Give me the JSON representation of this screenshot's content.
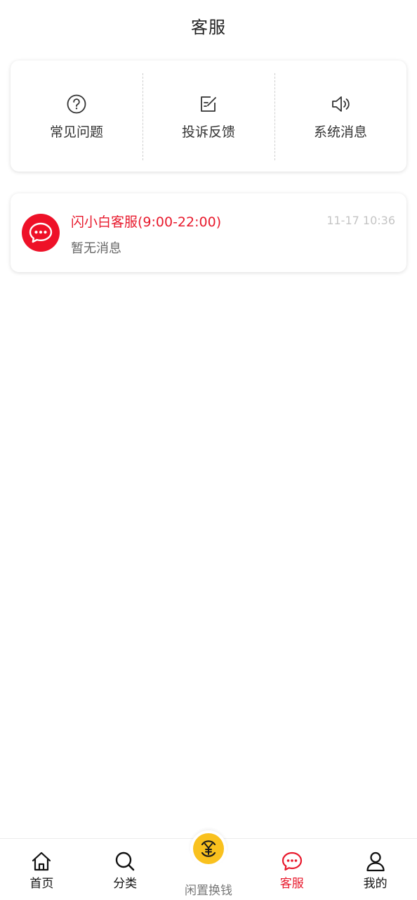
{
  "header": {
    "title": "客服"
  },
  "quick_actions": [
    {
      "label": "常见问题",
      "icon": "question-circle-icon"
    },
    {
      "label": "投诉反馈",
      "icon": "edit-note-icon"
    },
    {
      "label": "系统消息",
      "icon": "speaker-icon"
    }
  ],
  "conversation": {
    "name": "闪小白客服(9:00-22:00)",
    "time": "11-17 10:36",
    "preview": "暂无消息",
    "avatar_icon": "chat-bubble-icon"
  },
  "tabbar": {
    "items": [
      {
        "label": "首页",
        "icon": "home-icon"
      },
      {
        "label": "分类",
        "icon": "search-icon"
      },
      {
        "label": "闲置换钱",
        "icon": "yuan-coin-icon"
      },
      {
        "label": "客服",
        "icon": "chat-icon",
        "active": true
      },
      {
        "label": "我的",
        "icon": "user-icon"
      }
    ]
  },
  "colors": {
    "accent": "#e8192c",
    "avatar": "#ee1128",
    "coin": "#f9c11e",
    "muted": "#c4c4c4"
  }
}
